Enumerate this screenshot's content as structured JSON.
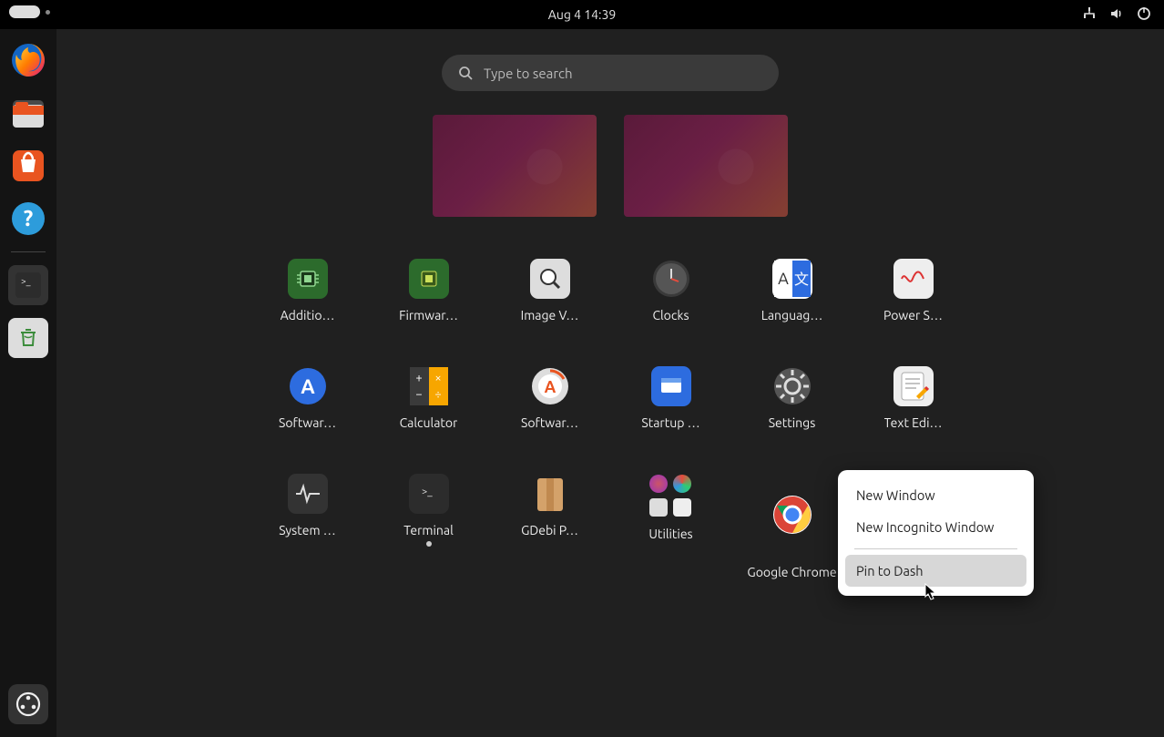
{
  "topbar": {
    "datetime": "Aug 4  14:39"
  },
  "search": {
    "placeholder": "Type to search"
  },
  "dock": {
    "items": [
      {
        "name": "firefox"
      },
      {
        "name": "files"
      },
      {
        "name": "software-store"
      },
      {
        "name": "help"
      }
    ],
    "below_separator": [
      {
        "name": "terminal"
      },
      {
        "name": "trash"
      }
    ],
    "show_apps": "Show Applications"
  },
  "apps": [
    {
      "id": "additional-drivers",
      "label": "Additio…"
    },
    {
      "id": "firmware-updater",
      "label": "Firmwar…"
    },
    {
      "id": "image-viewer",
      "label": "Image V…"
    },
    {
      "id": "clocks",
      "label": "Clocks"
    },
    {
      "id": "language-support",
      "label": "Languag…"
    },
    {
      "id": "power-statistics",
      "label": "Power S…"
    },
    {
      "id": "software-updates",
      "label": "Softwar…"
    },
    {
      "id": "calculator",
      "label": "Calculator"
    },
    {
      "id": "software-updater",
      "label": "Softwar…"
    },
    {
      "id": "startup-apps",
      "label": "Startup …"
    },
    {
      "id": "settings",
      "label": "Settings"
    },
    {
      "id": "text-editor",
      "label": "Text Edi…"
    },
    {
      "id": "system-monitor",
      "label": "System …"
    },
    {
      "id": "terminal",
      "label": "Terminal"
    },
    {
      "id": "gdebi",
      "label": "GDebi P…"
    },
    {
      "id": "utilities-folder",
      "label": "Utilities"
    },
    {
      "id": "google-chrome",
      "label": "Google Chrome"
    }
  ],
  "context_menu": {
    "items": [
      {
        "label": "New Window"
      },
      {
        "label": "New Incognito Window"
      }
    ],
    "pin_label": "Pin to Dash"
  }
}
